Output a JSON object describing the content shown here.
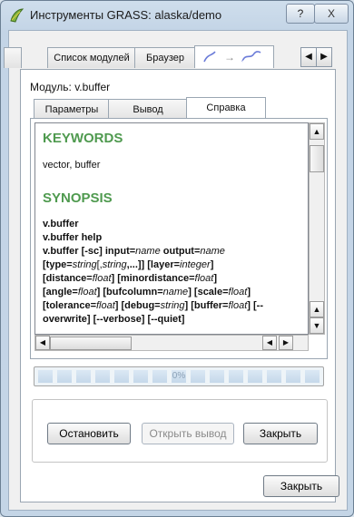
{
  "window": {
    "title": "Инструменты GRASS: alaska/demo",
    "help_button": "?",
    "close_button": "X"
  },
  "top_tabs": {
    "items": [
      {
        "label": "Список модулей"
      },
      {
        "label": "Браузер"
      }
    ],
    "scroll_left": "◀",
    "scroll_right": "▶"
  },
  "module": {
    "label": "Модуль: v.buffer"
  },
  "inner_tabs": {
    "items": [
      {
        "label": "Параметры"
      },
      {
        "label": "Вывод"
      },
      {
        "label": "Справка"
      }
    ]
  },
  "help": {
    "keywords_heading": "KEYWORDS",
    "keywords_text": "vector, buffer",
    "synopsis_heading": "SYNOPSIS",
    "lines": {
      "l1": "v.buffer",
      "l2": "v.buffer help",
      "l3_a": "v.buffer [-sc] input=",
      "l3_b": "name",
      "l3_c": " output=",
      "l3_d": "name",
      "l4_a": "[type=",
      "l4_b": "string",
      "l4_c": "[,",
      "l4_d": "string",
      "l4_e": ",...]] [layer=",
      "l4_f": "integer",
      "l4_g": "]",
      "l5_a": "[distance=",
      "l5_b": "float",
      "l5_c": "] [minordistance=",
      "l5_d": "float",
      "l5_e": "]",
      "l6_a": "[angle=",
      "l6_b": "float",
      "l6_c": "] [bufcolumn=",
      "l6_d": "name",
      "l6_e": "] [scale=",
      "l6_f": "float",
      "l6_g": "]",
      "l7_a": "[tolerance=",
      "l7_b": "float",
      "l7_c": "] [debug=",
      "l7_d": "string",
      "l7_e": "] [buffer=",
      "l7_f": "float",
      "l7_g": "] [--",
      "l8": "overwrite] [--verbose] [--quiet]"
    }
  },
  "scroll": {
    "up": "▲",
    "down": "▼",
    "left": "◀",
    "right": "▶"
  },
  "progress": {
    "text": "0%",
    "value": 0
  },
  "buttons": {
    "stop": "Остановить",
    "open_output": "Открыть вывод",
    "close": "Закрыть",
    "close_main": "Закрыть"
  },
  "icons": {
    "app": "grass-leaf-icon",
    "tab_plugins": "plugin-line-icons"
  }
}
